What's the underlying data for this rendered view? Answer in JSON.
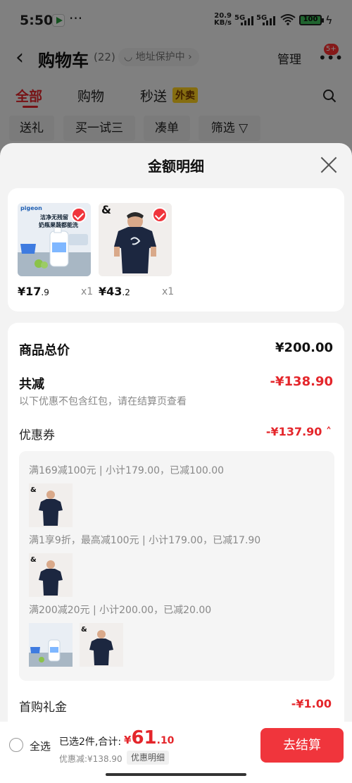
{
  "status_bar": {
    "time": "5:50",
    "more": "···",
    "net_speed": "20.9",
    "net_unit": "KB/s",
    "sim1": "5G",
    "sim2": "5G",
    "battery": "100"
  },
  "header": {
    "back_icon": "chevron-left-icon",
    "title": "购物车",
    "count": "(22)",
    "address_protect": "地址保护中",
    "manage": "管理",
    "more": "•••",
    "badge": "5+"
  },
  "tabs": [
    {
      "label": "全部",
      "active": true
    },
    {
      "label": "购物",
      "active": false
    },
    {
      "label": "秒送",
      "active": false
    }
  ],
  "tab_tag": "外卖",
  "chips": [
    "送礼",
    "买一试三",
    "凑单",
    "筛选"
  ],
  "sheet": {
    "title": "金额明细",
    "products": [
      {
        "price_int": "¥17",
        "price_dec": ".9",
        "qty": "x1",
        "brand": "pigeon",
        "caption1": "洁净无残留",
        "caption2": "奶瓶果蔬都能洗",
        "checked": true
      },
      {
        "price_int": "¥43",
        "price_dec": ".2",
        "qty": "x1",
        "brand": "&",
        "checked": true
      }
    ],
    "subtotal_label": "商品总价",
    "subtotal_value": "¥200.00",
    "reduce_label": "共减",
    "reduce_value": "-¥138.90",
    "note": "以下优惠不包含红包，请在结算页查看",
    "coupon_label": "优惠券",
    "coupon_value": "-¥137.90",
    "coupon_rules": [
      "满169减100元 | 小计179.00，已减100.00",
      "满1享9折，最高减100元 | 小计179.00，已减17.90",
      "满200减20元 | 小计200.00，已减20.00"
    ],
    "first_gift_label": "首购礼金",
    "first_gift_value": "-¥1.00"
  },
  "bottom_bar": {
    "select_all": "全选",
    "selected_text": "已选2件,合计:",
    "total_cur": "¥",
    "total_int": "61",
    "total_dec": ".10",
    "discount_text": "优惠减:¥138.90",
    "detail_button": "优惠明细",
    "checkout_button": "去结算"
  },
  "colors": {
    "accent": "#e4262b",
    "checkout": "#f0353c",
    "tag": "#ffd21f"
  }
}
